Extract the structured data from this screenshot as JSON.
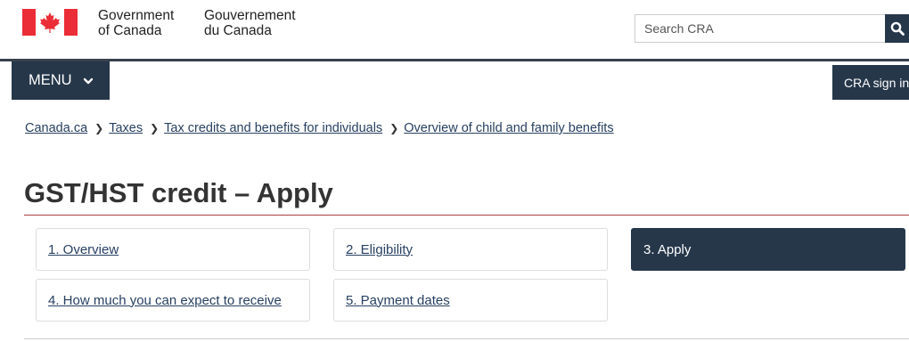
{
  "header": {
    "signature_en": [
      "Government",
      "of Canada"
    ],
    "signature_fr": [
      "Gouvernement",
      "du Canada"
    ],
    "search_placeholder": "Search CRA",
    "flag_color": "#eb2d37"
  },
  "nav": {
    "menu_label": "MENU",
    "signin_label": "CRA sign in"
  },
  "breadcrumb": [
    "Canada.ca",
    "Taxes",
    "Tax credits and benefits for individuals",
    "Overview of child and family benefits"
  ],
  "page": {
    "title": "GST/HST credit – Apply"
  },
  "steps": [
    {
      "label": "1. Overview",
      "active": false
    },
    {
      "label": "2. Eligibility",
      "active": false
    },
    {
      "label": "3. Apply",
      "active": true
    },
    {
      "label": "4. How much you can expect to receive",
      "active": false
    },
    {
      "label": "5. Payment dates",
      "active": false
    }
  ],
  "colors": {
    "accent_dark": "#26374a",
    "link": "#284162",
    "title_rule": "#af3c43"
  }
}
